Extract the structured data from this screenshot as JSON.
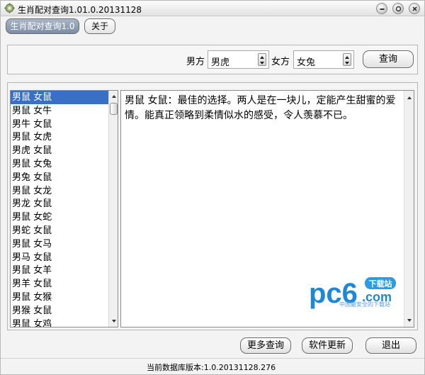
{
  "window": {
    "title": "生肖配对查询1.01.0.20131128"
  },
  "tabs": [
    {
      "label": "生肖配对查询1.0",
      "active": true
    },
    {
      "label": "关于",
      "active": false
    }
  ],
  "query": {
    "male_label": "男方",
    "male_value": "男虎",
    "female_label": "女方",
    "female_value": "女兔",
    "query_button": "查询"
  },
  "pair_list": {
    "items": [
      "男鼠 女鼠",
      "男鼠 女牛",
      "男牛 女鼠",
      "男鼠 女虎",
      "男虎 女鼠",
      "男鼠 女兔",
      "男兔 女鼠",
      "男鼠 女龙",
      "男龙 女鼠",
      "男鼠 女蛇",
      "男蛇 女鼠",
      "男鼠 女马",
      "男马 女鼠",
      "男鼠 女羊",
      "男羊 女鼠",
      "男鼠 女猴",
      "男猴 女鼠",
      "男鼠 女鸡"
    ],
    "selected_index": 0
  },
  "detail": {
    "text": "男鼠 女鼠：最佳的选择。两人是在一块儿，定能产生甜蜜的爱情。能真正领略到柔情似水的感受，令人羡慕不已。"
  },
  "watermark": {
    "logo_text": "pc6",
    "badge_text": "下载站",
    "domain_text": ".com",
    "sub_text": "中国最安全的下载站"
  },
  "footer": {
    "more_button": "更多查询",
    "update_button": "软件更新",
    "exit_button": "退出",
    "status_text": "当前数据库版本:1.0.20131128.276"
  },
  "colors": {
    "selection": "#3a6fc6",
    "active_tab": "#8b9bb1",
    "watermark_blue": "#1e88d8"
  },
  "icons": {
    "app": "gear-icon",
    "minimize": "minimize-icon",
    "restore": "restore-icon",
    "close": "close-icon"
  }
}
